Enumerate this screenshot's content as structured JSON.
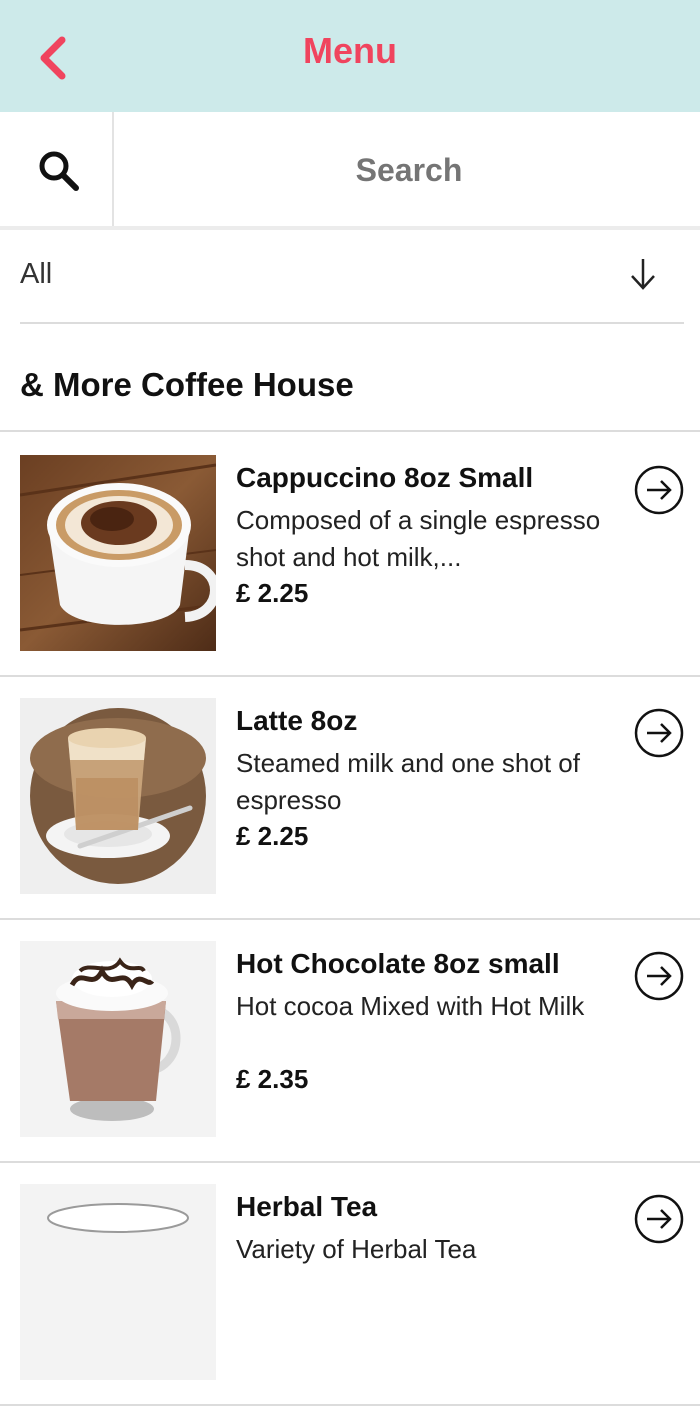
{
  "header": {
    "title": "Menu",
    "back_icon": "chevron-left-icon",
    "accent": "#f0445e",
    "background": "#cdeaea"
  },
  "search": {
    "placeholder": "Search",
    "icon": "search-icon"
  },
  "filter": {
    "label": "All",
    "icon": "arrow-down-icon"
  },
  "section": {
    "title": "& More Coffee House"
  },
  "items": [
    {
      "name": "Cappuccino 8oz Small",
      "description": "Composed of a single espresso shot and hot milk,...",
      "price": "£ 2.25",
      "image": "cappuccino-cup"
    },
    {
      "name": "Latte 8oz",
      "description": "Steamed milk and one shot of espresso",
      "price": "£ 2.25",
      "image": "latte-glass"
    },
    {
      "name": "Hot Chocolate 8oz small",
      "description": "Hot cocoa Mixed with Hot Milk",
      "price": "£ 2.35",
      "image": "hot-chocolate-mug"
    },
    {
      "name": "Herbal Tea",
      "description": "Variety of Herbal Tea",
      "price": "",
      "image": "herbal-tea-cup"
    }
  ]
}
